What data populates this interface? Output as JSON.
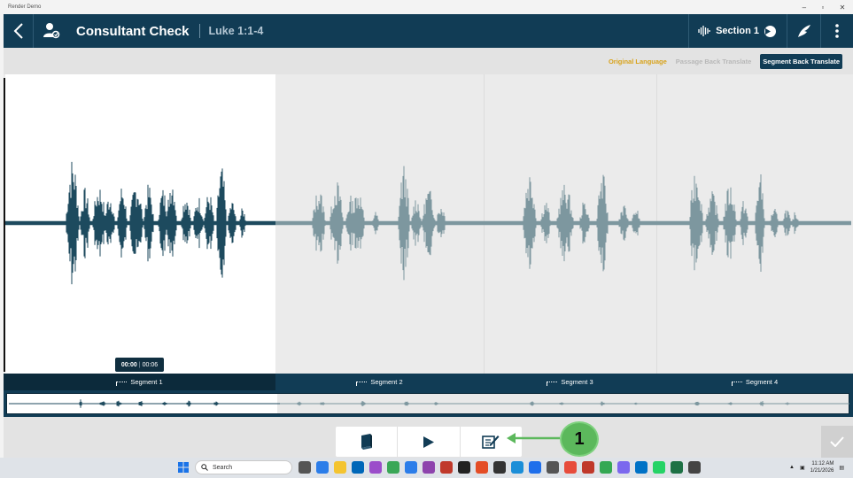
{
  "window": {
    "title": "Render Demo",
    "controls": [
      "–",
      "▫",
      "✕"
    ]
  },
  "appbar": {
    "title": "Consultant Check",
    "reference": "Luke 1:1-4",
    "section_label": "Section 1"
  },
  "toggles": {
    "original_language": "Original Language",
    "passage_back_translate": "Passage Back Translate",
    "segment_back_translate": "Segment Back Translate"
  },
  "player": {
    "current_time": "00:00",
    "separator": "|",
    "duration": "00:06"
  },
  "segments": [
    {
      "label": "Segment 1",
      "selected": true
    },
    {
      "label": "Segment 2",
      "selected": false
    },
    {
      "label": "Segment 3",
      "selected": false
    },
    {
      "label": "Segment 4",
      "selected": false
    }
  ],
  "bottom_toolbar": {
    "icons": [
      "book-icon",
      "play-icon",
      "note-edit-icon"
    ]
  },
  "annotation": {
    "callout_number": "1"
  },
  "taskbar": {
    "search_placeholder": "Search",
    "time": "11:12 AM",
    "date": "1/21/2026"
  },
  "colors": {
    "appbar": "#113c55",
    "active_wave": "#1d4a5e",
    "inactive_wave": "#7d979f",
    "accent_orange": "#d8a21a",
    "callout_green": "#5cb85c"
  }
}
